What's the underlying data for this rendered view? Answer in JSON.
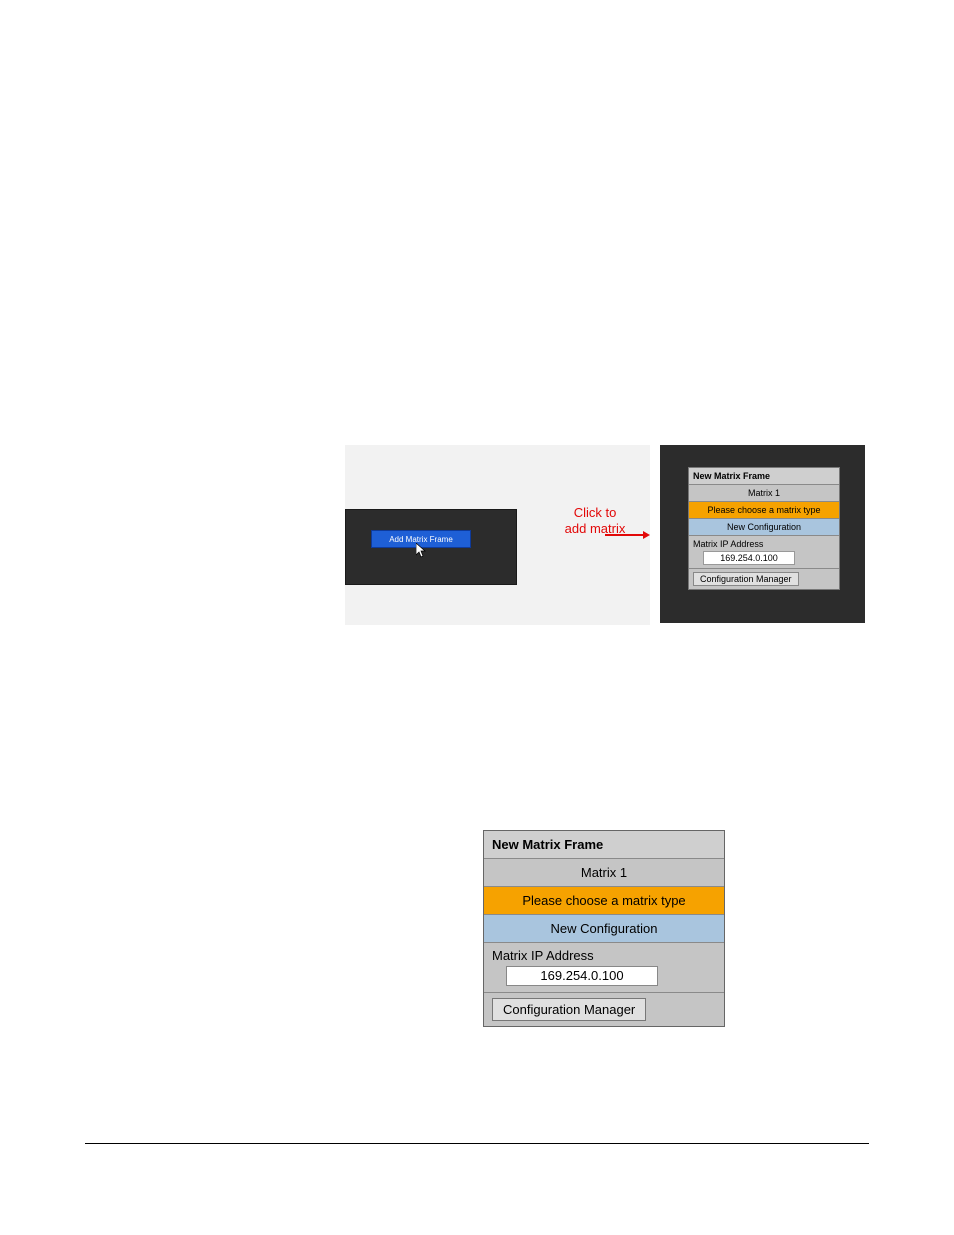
{
  "annotation": {
    "line1": "Click to",
    "line2": "add matrix"
  },
  "add_matrix_button_label": "Add Matrix Frame",
  "matrix_panel": {
    "title": "New Matrix Frame",
    "name": "Matrix 1",
    "choose_type": "Please choose a matrix type",
    "new_config": "New Configuration",
    "ip_label": "Matrix IP Address",
    "ip_value": "169.254.0.100",
    "config_manager": "Configuration Manager"
  }
}
